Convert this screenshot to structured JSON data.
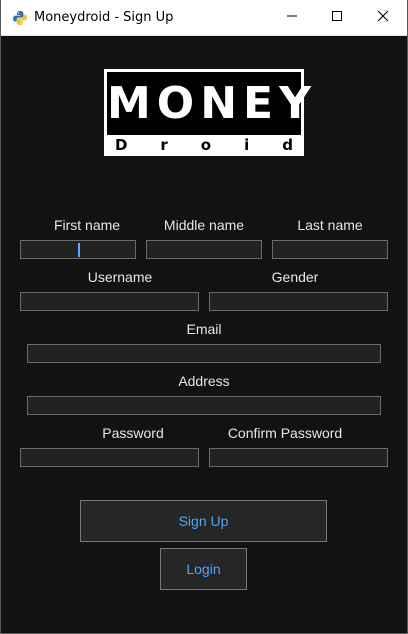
{
  "window": {
    "title": "Moneydroid - Sign Up"
  },
  "logo": {
    "top_text": "MONEY",
    "bottom_letters": [
      "D",
      "r",
      "o",
      "i",
      "d"
    ]
  },
  "form": {
    "first_name_label": "First name",
    "middle_name_label": "Middle name",
    "last_name_label": "Last name",
    "username_label": "Username",
    "gender_label": "Gender",
    "email_label": "Email",
    "address_label": "Address",
    "password_label": "Password",
    "confirm_password_label": "Confirm Password",
    "first_name_value": "",
    "middle_name_value": "",
    "last_name_value": "",
    "username_value": "",
    "gender_value": "",
    "email_value": "",
    "address_value": "",
    "password_value": "",
    "confirm_password_value": ""
  },
  "buttons": {
    "signup_label": "Sign Up",
    "login_label": "Login"
  },
  "colors": {
    "background": "#121212",
    "field_background": "#222222",
    "field_border": "#6b6b6b",
    "button_text": "#4da3ff",
    "label_text": "#e6e6e6"
  },
  "icons": {
    "app": "python-icon",
    "minimize": "minimize-icon",
    "maximize": "maximize-icon",
    "close": "close-icon"
  }
}
